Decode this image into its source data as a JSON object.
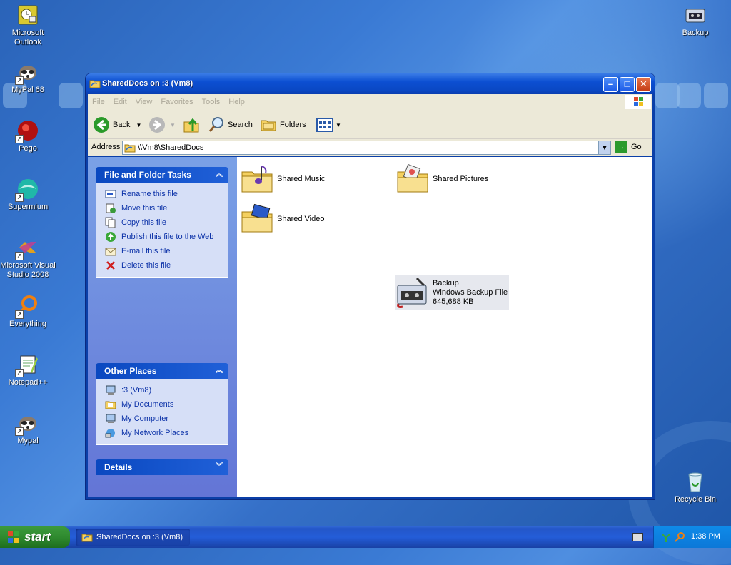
{
  "desktop": {
    "icons_left": [
      {
        "label": "Microsoft Outlook",
        "icon": "outlook-icon"
      },
      {
        "label": "MyPal 68",
        "icon": "raccoon-icon"
      },
      {
        "label": "Pego",
        "icon": "pego-icon"
      },
      {
        "label": "Supermium",
        "icon": "supermium-icon"
      },
      {
        "label": "Microsoft Visual Studio 2008",
        "icon": "visual-studio-icon"
      },
      {
        "label": "Everything",
        "icon": "everything-icon"
      },
      {
        "label": "Notepad++",
        "icon": "notepadpp-icon"
      },
      {
        "label": "Mypal",
        "icon": "raccoon-icon"
      }
    ],
    "backup_label": "Backup",
    "recycle_label": "Recycle Bin"
  },
  "window": {
    "title": "SharedDocs on :3 (Vm8)",
    "menu": [
      "File",
      "Edit",
      "View",
      "Favorites",
      "Tools",
      "Help"
    ],
    "toolbar": {
      "back": "Back",
      "search": "Search",
      "folders": "Folders"
    },
    "address": {
      "label": "Address",
      "value": "\\\\Vm8\\SharedDocs",
      "go": "Go"
    }
  },
  "tasks_panel": {
    "title": "File and Folder Tasks",
    "items": [
      {
        "label": "Rename this file",
        "icon": "rename-icon"
      },
      {
        "label": "Move this file",
        "icon": "move-icon"
      },
      {
        "label": "Copy this file",
        "icon": "copy-icon"
      },
      {
        "label": "Publish this file to the Web",
        "icon": "publish-icon"
      },
      {
        "label": "E-mail this file",
        "icon": "email-icon"
      },
      {
        "label": "Delete this file",
        "icon": "delete-icon"
      }
    ]
  },
  "places_panel": {
    "title": "Other Places",
    "items": [
      {
        "label": ":3 (Vm8)",
        "icon": "computer-icon"
      },
      {
        "label": "My Documents",
        "icon": "my-documents-icon"
      },
      {
        "label": "My Computer",
        "icon": "computer-icon"
      },
      {
        "label": "My Network Places",
        "icon": "network-icon"
      }
    ]
  },
  "details_panel": {
    "title": "Details"
  },
  "files": [
    {
      "name": "Shared Music",
      "icon": "music-folder-icon"
    },
    {
      "name": "Shared Pictures",
      "icon": "pictures-folder-icon"
    },
    {
      "name": "Shared Video",
      "icon": "video-folder-icon"
    },
    {
      "name": "Backup",
      "type": "Windows Backup File",
      "size": "645,688 KB",
      "icon": "backup-file-icon"
    }
  ],
  "taskbar": {
    "start": "start",
    "task_label": "SharedDocs on :3 (Vm8)",
    "clock": "1:38 PM"
  }
}
